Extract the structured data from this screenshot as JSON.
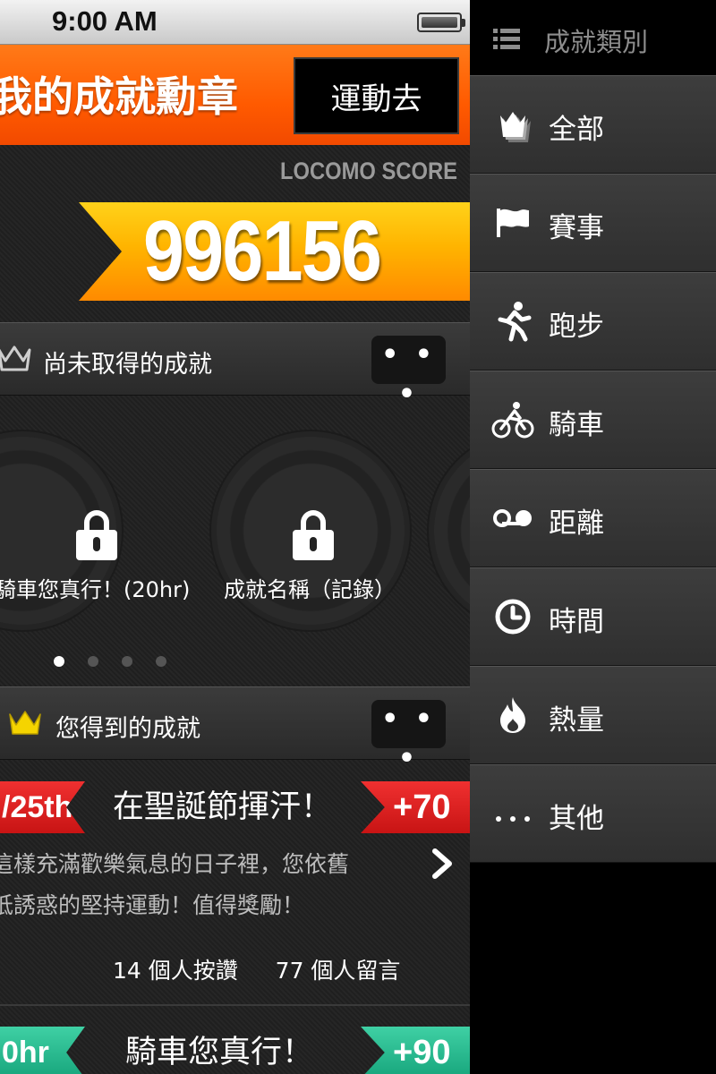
{
  "status_bar": {
    "time": "9:00 AM"
  },
  "header": {
    "title": "我的成就勳章",
    "action_label": "運動去"
  },
  "score": {
    "label": "LOCOMO SCORE",
    "value": "996156"
  },
  "unearned_section": {
    "title": "尚未取得的成就",
    "more_label": "• • •",
    "badges": [
      {
        "name": "騎車您真行！(20hr)"
      },
      {
        "name": "成就名稱（記錄）"
      }
    ],
    "page_dots": {
      "total": 4,
      "active": 1
    }
  },
  "earned_section": {
    "title": "您得到的成就",
    "more_label": "• • •"
  },
  "feed": [
    {
      "date_tag": "/25th",
      "title": "在聖誕節揮汗！",
      "points": "+70",
      "description_lines": [
        "這樣充滿歡樂氣息的日子裡，您依舊",
        "抵誘惑的堅持運動！值得獎勵！"
      ],
      "likes_text": "14 個人按讚",
      "comments_text": "77 個人留言",
      "color": "#e02020"
    },
    {
      "date_tag": "0hr",
      "title": "騎車您真行！",
      "points": "+90",
      "color": "#24b98c"
    }
  ],
  "menu": {
    "title": "成就類別",
    "items": [
      {
        "label": "全部",
        "icon": "crowns-icon"
      },
      {
        "label": "賽事",
        "icon": "flag-icon"
      },
      {
        "label": "跑步",
        "icon": "runner-icon"
      },
      {
        "label": "騎車",
        "icon": "cyclist-icon"
      },
      {
        "label": "距離",
        "icon": "distance-icon"
      },
      {
        "label": "時間",
        "icon": "clock-icon"
      },
      {
        "label": "熱量",
        "icon": "flame-icon"
      },
      {
        "label": "其他",
        "icon": "more-dots-icon"
      }
    ]
  },
  "colors": {
    "accent_orange": "#ff5a00",
    "score_gold": "#ffb400",
    "crown_yellow": "#f5d400"
  }
}
